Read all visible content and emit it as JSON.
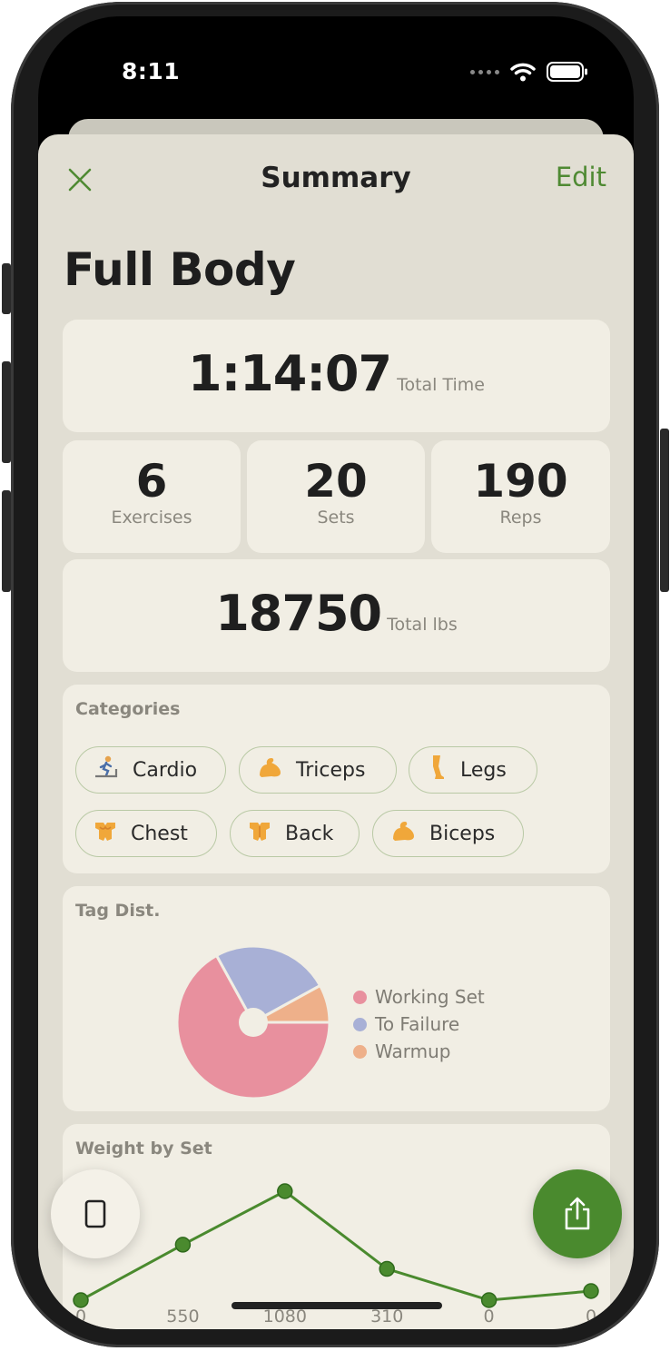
{
  "status": {
    "time": "8:11"
  },
  "nav": {
    "title": "Summary",
    "edit_label": "Edit"
  },
  "workout": {
    "title": "Full Body"
  },
  "stats": {
    "total_time": "1:14:07",
    "total_time_label": "Total Time",
    "exercises": "6",
    "exercises_label": "Exercises",
    "sets": "20",
    "sets_label": "Sets",
    "reps": "190",
    "reps_label": "Reps",
    "total_lbs": "18750",
    "total_lbs_label": "Total lbs"
  },
  "categories": {
    "label": "Categories",
    "items": [
      {
        "label": "Cardio",
        "icon": "treadmill-icon"
      },
      {
        "label": "Triceps",
        "icon": "flexed-arm-icon"
      },
      {
        "label": "Legs",
        "icon": "leg-icon"
      },
      {
        "label": "Chest",
        "icon": "chest-icon"
      },
      {
        "label": "Back",
        "icon": "back-icon"
      },
      {
        "label": "Biceps",
        "icon": "flexed-arm-icon"
      }
    ]
  },
  "tag_dist": {
    "label": "Tag Dist.",
    "legend": [
      "Working Set",
      "To Failure",
      "Warmup"
    ]
  },
  "weight_by_set": {
    "label": "Weight by Set",
    "point_labels": [
      "0",
      "550",
      "1080",
      "310",
      "0",
      "0"
    ]
  },
  "colors": {
    "accent": "#4f8a33",
    "working_set": "#e8909e",
    "to_failure": "#a8b0d6",
    "warmup": "#eeb08a",
    "line": "#4a8a2e"
  },
  "chart_data": [
    {
      "type": "pie",
      "categories": [
        "Working Set",
        "To Failure",
        "Warmup"
      ],
      "values": [
        67,
        25,
        8
      ]
    },
    {
      "type": "line",
      "x": [
        1,
        2,
        3,
        4,
        5,
        6
      ],
      "values": [
        0,
        550,
        1080,
        310,
        0,
        90
      ],
      "ylim": [
        0,
        1080
      ]
    }
  ]
}
